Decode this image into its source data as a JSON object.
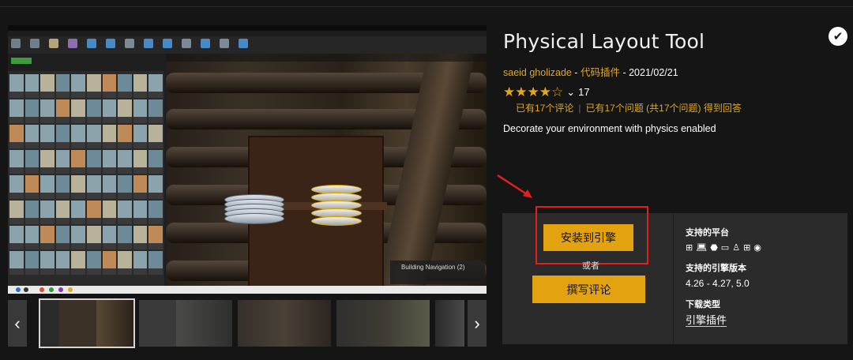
{
  "product": {
    "title": "Physical Layout Tool",
    "author": "saeid gholizade",
    "separator1": " - ",
    "category": "代码插件",
    "separator2": " - ",
    "date": "2021/02/21",
    "rating_value": 4,
    "rating_max": 5,
    "rating_count": "17",
    "reviews_text": "已有17个评论",
    "questions_text": "已有17个问题 (共17个问题) 得到回答",
    "description": "Decorate your environment with physics enabled"
  },
  "purchase": {
    "install_label": "安装到引擎",
    "or_label": "或者",
    "review_label": "撰写评论",
    "platforms_title": "支持的平台",
    "platform_icons": [
      "windows-icon",
      "laptop-icon",
      "android-icon",
      "vr-icon",
      "linux-icon",
      "windows-icon",
      "eye-icon",
      "apple-icon"
    ],
    "engine_title": "支持的引擎版本",
    "engine_versions": "4.26 - 4.27, 5.0",
    "download_type_title": "下载类型",
    "download_type_value": "引擎插件"
  },
  "hero": {
    "viewport_caption": "Building Navigation (2)"
  },
  "gallery": {
    "prev_glyph": "‹",
    "next_glyph": "›",
    "thumb_count": 5,
    "selected_index": 0
  },
  "colors": {
    "accent": "#e3a311",
    "highlight_box": "#e02020",
    "background": "#151515",
    "panel": "#2b2b2b"
  }
}
